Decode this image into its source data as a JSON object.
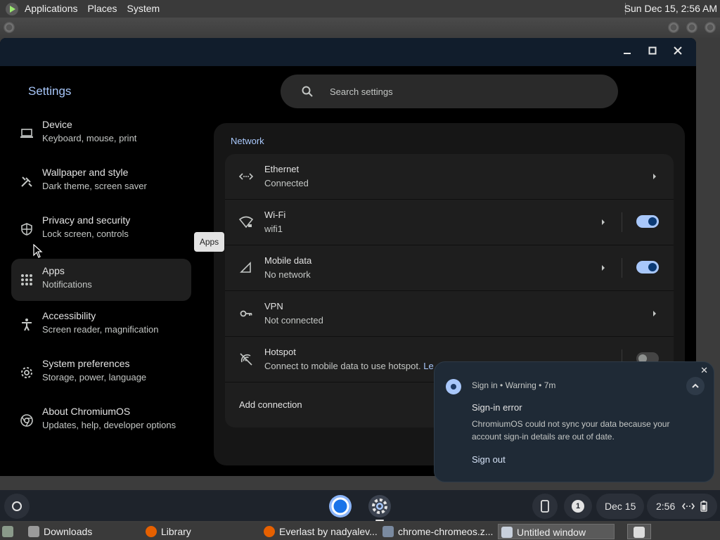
{
  "top_panel": {
    "menus": [
      "Applications",
      "Places",
      "System"
    ],
    "clock": "Sun Dec 15,  2:56 AM"
  },
  "settings": {
    "title": "Settings",
    "search_placeholder": "Search settings",
    "nav": [
      {
        "label": "Device",
        "sub": "Keyboard, mouse, print",
        "icon": "laptop-icon"
      },
      {
        "label": "Wallpaper and style",
        "sub": "Dark theme, screen saver",
        "icon": "paint-icon"
      },
      {
        "label": "Privacy and security",
        "sub": "Lock screen, controls",
        "icon": "shield-icon"
      },
      {
        "label": "Apps",
        "sub": "Notifications",
        "icon": "apps-grid-icon",
        "active": true
      },
      {
        "label": "Accessibility",
        "sub": "Screen reader, magnification",
        "icon": "accessibility-icon"
      },
      {
        "label": "System preferences",
        "sub": "Storage, power, language",
        "icon": "gear-icon"
      },
      {
        "label": "About ChromiumOS",
        "sub": "Updates, help, developer options",
        "icon": "chromium-icon"
      }
    ],
    "tooltip": "Apps",
    "network": {
      "title": "Network",
      "rows": [
        {
          "label": "Ethernet",
          "sub": "Connected",
          "icon": "ethernet-icon"
        },
        {
          "label": "Wi-Fi",
          "sub": "wifi1",
          "icon": "wifi-lock-icon",
          "toggle": true
        },
        {
          "label": "Mobile data",
          "sub": "No network",
          "icon": "cellular-icon",
          "toggle": true
        },
        {
          "label": "VPN",
          "sub": "Not connected",
          "icon": "vpn-key-icon"
        },
        {
          "label": "Hotspot",
          "sub": "Connect to mobile data to use hotspot.",
          "sub_link": "Le",
          "icon": "hotspot-off-icon",
          "toggle": false
        }
      ],
      "add_connection": "Add connection"
    }
  },
  "notification": {
    "source": "Sign in",
    "level": "Warning",
    "age": "7m",
    "title": "Sign-in error",
    "body": "ChromiumOS could not sync your data because your account sign-in details are out of date.",
    "action": "Sign out"
  },
  "shelf": {
    "notification_count": "1",
    "date": "Dec 15",
    "time": "2:56"
  },
  "taskbar": {
    "tasks": [
      "Downloads",
      "Library",
      "Everlast by nadyalev...",
      "chrome-chromeos.z...",
      "Untitled window"
    ]
  },
  "colors": {
    "accent": "#a8c7fa",
    "toggle_knob": "#0b3a74",
    "window_bg": "#000000",
    "card_bg": "#1e1e1e",
    "notification_bg": "#1f2a36"
  }
}
